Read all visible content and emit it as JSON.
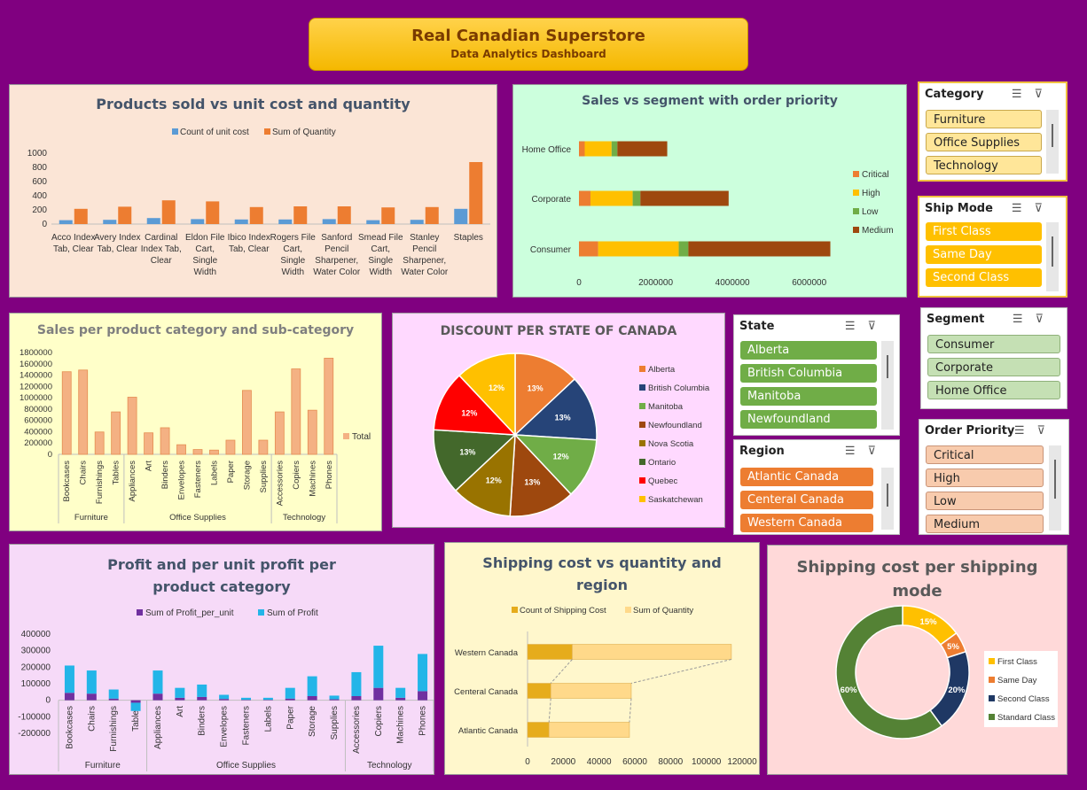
{
  "header": {
    "title": "Real Canadian Superstore",
    "subtitle": "Data Analytics Dashboard"
  },
  "chart_data": [
    {
      "id": "products",
      "type": "bar",
      "title": "Products sold vs unit cost and quantity",
      "categories": [
        "Acco Index Tab, Clear",
        "Avery Index Tab, Clear",
        "Cardinal Index Tab, Clear",
        "Eldon File Cart, Single Width",
        "Ibico Index Tab, Clear",
        "Rogers File Cart, Single Width",
        "Sanford Pencil Sharpener, Water Color",
        "Smead File Cart, Single Width",
        "Stanley Pencil Sharpener, Water Color",
        "Staples"
      ],
      "series": [
        {
          "name": "Count of unit cost",
          "color": "#5b9bd5",
          "values": [
            55,
            60,
            85,
            70,
            65,
            65,
            70,
            55,
            60,
            215
          ]
        },
        {
          "name": "Sum of Quantity",
          "color": "#ed7d31",
          "values": [
            215,
            245,
            335,
            320,
            240,
            250,
            250,
            235,
            240,
            875
          ]
        }
      ],
      "ylim": [
        0,
        1000
      ],
      "yticks": [
        0,
        200,
        400,
        600,
        800,
        1000
      ],
      "legend": "top"
    },
    {
      "id": "segment",
      "type": "bar",
      "orientation": "horizontal-stacked",
      "title": "Sales vs segment with order priority",
      "categories": [
        "Home Office",
        "Corporate",
        "Consumer"
      ],
      "series": [
        {
          "name": "Critical",
          "color": "#ed7d31",
          "values": [
            150000,
            300000,
            500000
          ]
        },
        {
          "name": "High",
          "color": "#ffc000",
          "values": [
            700000,
            1100000,
            2100000
          ]
        },
        {
          "name": "Low",
          "color": "#70ad47",
          "values": [
            150000,
            200000,
            250000
          ]
        },
        {
          "name": "Medium",
          "color": "#9e480e",
          "values": [
            1300000,
            2300000,
            3700000
          ]
        }
      ],
      "xlim": [
        0,
        7000000
      ],
      "xticks": [
        0,
        2000000,
        4000000,
        6000000
      ],
      "legend": "right"
    },
    {
      "id": "salescat",
      "type": "bar",
      "title": "Sales per product category and sub-category",
      "groups": [
        {
          "name": "Furniture",
          "categories": [
            "Bookcases",
            "Chairs",
            "Furnishings",
            "Tables"
          ]
        },
        {
          "name": "Office Supplies",
          "categories": [
            "Appliances",
            "Art",
            "Binders",
            "Envelopes",
            "Fasteners",
            "Labels",
            "Paper",
            "Storage",
            "Supplies"
          ]
        },
        {
          "name": "Technology",
          "categories": [
            "Accessories",
            "Copiers",
            "Machines",
            "Phones"
          ]
        }
      ],
      "series": [
        {
          "name": "Total",
          "color": "#f4b183",
          "values": [
            1460000,
            1490000,
            395000,
            750000,
            1010000,
            380000,
            470000,
            170000,
            85000,
            75000,
            250000,
            1130000,
            250000,
            750000,
            1510000,
            780000,
            1700000
          ]
        }
      ],
      "ylim": [
        0,
        1800000
      ],
      "yticks": [
        0,
        200000,
        400000,
        600000,
        800000,
        1000000,
        1200000,
        1400000,
        1600000,
        1800000
      ],
      "legend": "right"
    },
    {
      "id": "discount",
      "type": "pie",
      "title": "DISCOUNT PER STATE OF CANADA",
      "labels": [
        "Alberta",
        "British Columbia",
        "Manitoba",
        "Newfoundland",
        "Nova Scotia",
        "Ontario",
        "Quebec",
        "Saskatchewan"
      ],
      "values": [
        13,
        13,
        12,
        13,
        12,
        13,
        12,
        12
      ],
      "value_labels": [
        "13%",
        "13%",
        "12%",
        "13%",
        "12%",
        "13%",
        "12%",
        "12%"
      ],
      "colors": [
        "#ed7d31",
        "#264478",
        "#70ad47",
        "#9e480e",
        "#997300",
        "#43682b",
        "#ff0000",
        "#ffc000"
      ],
      "legend": "right"
    },
    {
      "id": "profit",
      "type": "bar",
      "orientation": "stacked",
      "title": "Profit and per unit profit per product category",
      "groups": [
        {
          "name": "Furniture",
          "categories": [
            "Bookcases",
            "Chairs",
            "Furnishings",
            "Tables"
          ]
        },
        {
          "name": "Office Supplies",
          "categories": [
            "Appliances",
            "Art",
            "Binders",
            "Envelopes",
            "Fasteners",
            "Labels",
            "Paper",
            "Storage",
            "Supplies"
          ]
        },
        {
          "name": "Technology",
          "categories": [
            "Accessories",
            "Copiers",
            "Machines",
            "Phones"
          ]
        }
      ],
      "series": [
        {
          "name": "Sum of Profit_per_unit",
          "color": "#7030a0",
          "values": [
            45000,
            40000,
            10000,
            -15000,
            40000,
            15000,
            20000,
            8000,
            3000,
            3000,
            10000,
            25000,
            6000,
            25000,
            75000,
            15000,
            55000
          ]
        },
        {
          "name": "Sum of Profit",
          "color": "#23b5e8",
          "values": [
            165000,
            140000,
            55000,
            -50000,
            140000,
            60000,
            75000,
            25000,
            12000,
            12000,
            65000,
            120000,
            22000,
            145000,
            255000,
            60000,
            225000
          ]
        }
      ],
      "ylim": [
        -200000,
        400000
      ],
      "yticks": [
        -200000,
        -100000,
        0,
        100000,
        200000,
        300000,
        400000
      ],
      "legend": "top"
    },
    {
      "id": "shipping",
      "type": "bar",
      "orientation": "horizontal-stacked",
      "title": "Shipping cost vs quantity and region",
      "categories": [
        "Western Canada",
        "Centeral Canada",
        "Atlantic Canada"
      ],
      "series": [
        {
          "name": "Count of Shipping Cost",
          "color": "#e6ac1c",
          "values": [
            25000,
            13000,
            12000
          ]
        },
        {
          "name": "Sum of Quantity",
          "color": "#ffd98a",
          "values": [
            89000,
            45000,
            45000
          ]
        }
      ],
      "xlim": [
        0,
        120000
      ],
      "xticks": [
        0,
        20000,
        40000,
        60000,
        80000,
        100000,
        120000
      ],
      "legend": "top"
    },
    {
      "id": "shipmode",
      "type": "pie",
      "variant": "doughnut",
      "title": "Shipping cost per shipping mode",
      "labels": [
        "First Class",
        "Same Day",
        "Second Class",
        "Standard Class"
      ],
      "values": [
        15,
        5,
        20,
        60
      ],
      "value_labels": [
        "15%",
        "5%",
        "20%",
        "60%"
      ],
      "colors": [
        "#ffc000",
        "#ed7d31",
        "#1f3864",
        "#548235"
      ],
      "legend": "right"
    }
  ],
  "slicers": {
    "category": {
      "title": "Category",
      "items": [
        "Furniture",
        "Office Supplies",
        "Technology"
      ]
    },
    "shipmode": {
      "title": "Ship Mode",
      "items": [
        "First Class",
        "Same Day",
        "Second Class"
      ]
    },
    "segment": {
      "title": "Segment",
      "items": [
        "Consumer",
        "Corporate",
        "Home Office"
      ]
    },
    "state": {
      "title": "State",
      "items": [
        "Alberta",
        "British Columbia",
        "Manitoba",
        "Newfoundland"
      ]
    },
    "region": {
      "title": "Region",
      "items": [
        "Atlantic Canada",
        "Centeral Canada",
        "Western Canada"
      ]
    },
    "priority": {
      "title": "Order Priority",
      "items": [
        "Critical",
        "High",
        "Low",
        "Medium"
      ]
    }
  }
}
